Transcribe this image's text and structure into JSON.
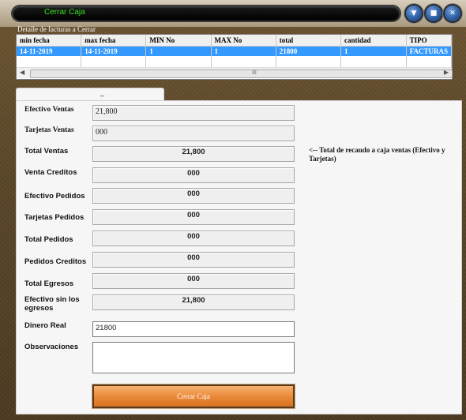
{
  "window": {
    "title": "Cerrar Caja",
    "buttons": [
      "minimize-icon",
      "maximize-icon",
      "close-icon"
    ]
  },
  "invoices": {
    "section_label": "Detalle de facturas a Cerrar",
    "columns": [
      "min fecha",
      "max fecha",
      "MIN No",
      "MAX No",
      "total",
      "cantidad",
      "TIPO"
    ],
    "rows": [
      [
        "14-11-2019",
        "14-11-2019",
        "1",
        "1",
        "21800",
        "1",
        "FACTURAS"
      ]
    ],
    "scroll_grip": "III"
  },
  "tab": {
    "label": "_"
  },
  "form": {
    "efectivo_ventas": {
      "label": "Efectivo Ventas",
      "value": "21,800"
    },
    "tarjetas_ventas": {
      "label": "Tarjetas Ventas",
      "value": "000"
    },
    "total_ventas": {
      "label": "Total Ventas",
      "value": "21,800"
    },
    "venta_creditos": {
      "label": "Venta Creditos",
      "value": "000"
    },
    "efectivo_pedidos": {
      "label": "Efectivo Pedidos",
      "value": "000"
    },
    "tarjetas_pedidos": {
      "label": "Tarjetas Pedidos",
      "value": "000"
    },
    "total_pedidos": {
      "label": "Total Pedidos",
      "value": "000"
    },
    "pedidos_creditos": {
      "label": "Pedidos Creditos",
      "value": "000"
    },
    "total_egresos": {
      "label": "Total Egresos",
      "value": "000"
    },
    "efectivo_sin_egresos": {
      "label": "Efectivo sin los egresos",
      "value": "21,800"
    },
    "dinero_real": {
      "label": "Dinero Real",
      "value": "21800"
    },
    "observaciones": {
      "label": "Observaciones",
      "value": ""
    },
    "note": "<-- Total de recaudo a caja ventas (Efectivo y Tarjetas)",
    "submit_label": "Cerrar Caja"
  },
  "colors": {
    "title_text": "#34e51e",
    "selection": "#3399ff",
    "button": "#ea8a3a"
  }
}
